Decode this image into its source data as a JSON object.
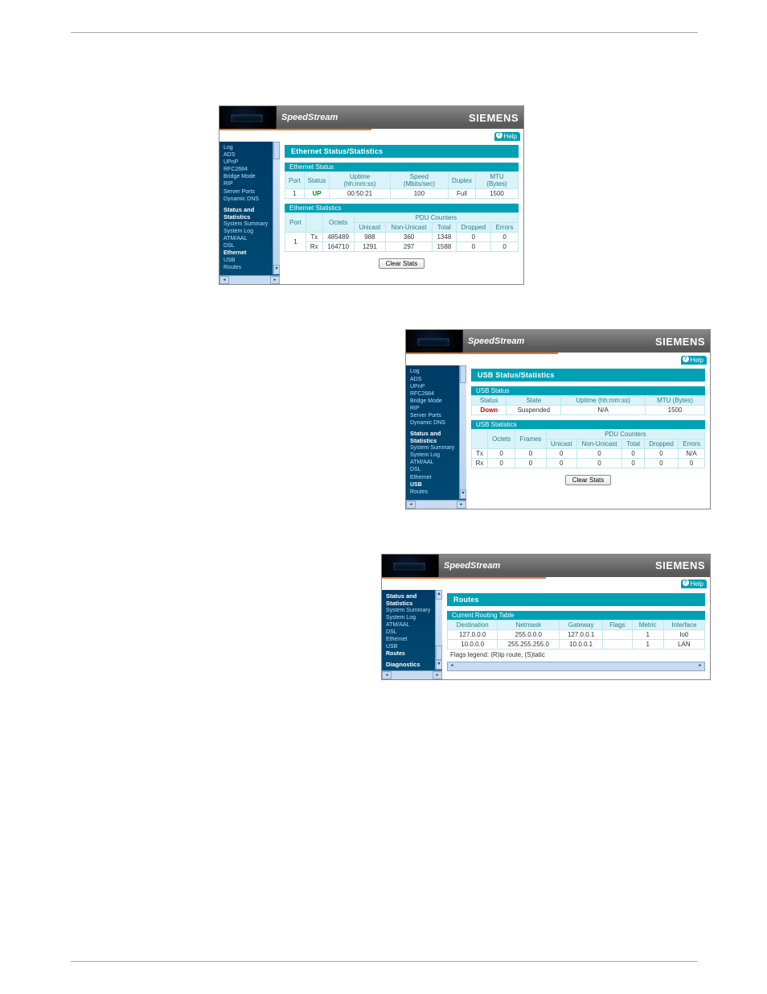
{
  "brand": {
    "product": "SpeedStream",
    "company": "SIEMENS",
    "help": "Help"
  },
  "sidebar_full": {
    "top": [
      "Log",
      "ADS",
      "UPnP",
      "RFC2684",
      "Bridge Mode",
      "RIP",
      "Server Ports",
      "Dynamic DNS"
    ],
    "section1": "Status and Statistics",
    "mid": [
      "System Summary",
      "System Log",
      "ATM/AAL",
      "DSL",
      "Ethernet",
      "USB",
      "Routes"
    ],
    "section2": "Diagnostics"
  },
  "sidebar_short": {
    "section1": "Status and Statistics",
    "items": [
      "System Summary",
      "System Log",
      "ATM/AAL",
      "DSL",
      "Ethernet",
      "USB",
      "Routes"
    ],
    "section2": "Diagnostics"
  },
  "shot1": {
    "title": "Ethernet Status/Statistics",
    "status_head": "Ethernet Status",
    "cols": [
      "Port",
      "Status",
      "Uptime (hh:mm:ss)",
      "Speed (Mbits/sec)",
      "Duplex",
      "MTU (Bytes)"
    ],
    "row": [
      "1",
      "UP",
      "00:50:21",
      "100",
      "Full",
      "1500"
    ],
    "stats_head": "Ethernet Statistics",
    "stats_group": "PDU Counters",
    "stats_cols_left": [
      "Port",
      "",
      "Octets"
    ],
    "stats_cols_right": [
      "Unicast",
      "Non-Unicast",
      "Total",
      "Dropped",
      "Errors"
    ],
    "tx": [
      "Tx",
      "485489",
      "988",
      "360",
      "1348",
      "0",
      "0"
    ],
    "rx": [
      "Rx",
      "164710",
      "1291",
      "297",
      "1588",
      "0",
      "0"
    ],
    "port": "1",
    "clear": "Clear Stats"
  },
  "shot2": {
    "title": "USB Status/Statistics",
    "status_head": "USB Status",
    "cols": [
      "Status",
      "State",
      "Uptime (hh:mm:ss)",
      "MTU (Bytes)"
    ],
    "row": [
      "Down",
      "Suspended",
      "N/A",
      "1500"
    ],
    "stats_head": "USB Statistics",
    "stats_group": "PDU Counters",
    "stats_left": [
      "",
      "Octets",
      "Frames"
    ],
    "stats_right": [
      "Unicast",
      "Non-Unicast",
      "Total",
      "Dropped",
      "Errors"
    ],
    "tx": [
      "Tx",
      "0",
      "0",
      "0",
      "0",
      "0",
      "0",
      "N/A"
    ],
    "rx": [
      "Rx",
      "0",
      "0",
      "0",
      "0",
      "0",
      "0",
      "0"
    ],
    "clear": "Clear Stats"
  },
  "shot3": {
    "title": "Routes",
    "table_head": "Current Routing Table",
    "cols": [
      "Destination",
      "Netmask",
      "Gateway",
      "Flags",
      "Metric",
      "Interface"
    ],
    "rows": [
      [
        "127.0.0.0",
        "255.0.0.0",
        "127.0.0.1",
        "",
        "1",
        "lo0"
      ],
      [
        "10.0.0.0",
        "255.255.255.0",
        "10.0.0.1",
        "",
        "1",
        "LAN"
      ]
    ],
    "legend": "Flags legend: (R)ip route, (S)tatic"
  }
}
